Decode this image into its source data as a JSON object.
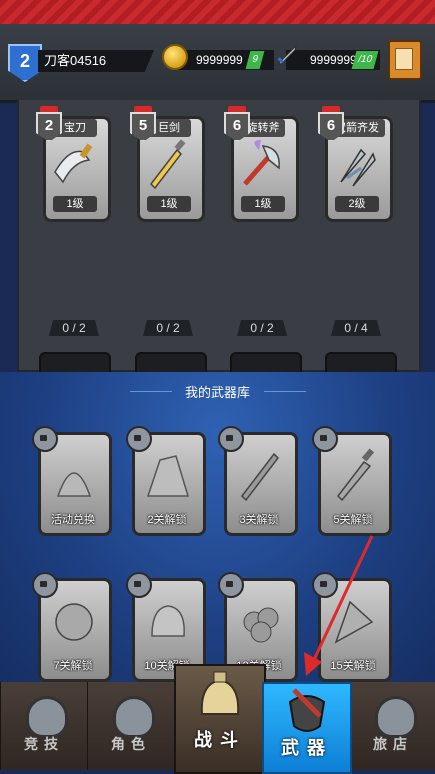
{
  "player": {
    "level": "2",
    "name": "刀客04516"
  },
  "resources": {
    "gold": "9999999",
    "gold_plus": "9",
    "energy": "99999999",
    "energy_max": "/10"
  },
  "equipped": [
    {
      "name": "宝刀",
      "badge": "2",
      "level": "1级",
      "progress": "0 / 2"
    },
    {
      "name": "巨剑",
      "badge": "5",
      "level": "1级",
      "progress": "0 / 2"
    },
    {
      "name": "旋转斧",
      "badge": "6",
      "level": "1级",
      "progress": "0 / 2"
    },
    {
      "name": "双箭齐发",
      "badge": "6",
      "level": "2级",
      "progress": "0 / 4"
    }
  ],
  "library": {
    "title": "我的武器库",
    "items": [
      {
        "caption": "活动兑换"
      },
      {
        "caption": "2关解锁"
      },
      {
        "caption": "3关解锁"
      },
      {
        "caption": "5关解锁"
      },
      {
        "caption": "7关解锁"
      },
      {
        "caption": "10关解锁"
      },
      {
        "caption": "12关解锁"
      },
      {
        "caption": "15关解锁"
      }
    ]
  },
  "nav": {
    "arena": "竞技",
    "character": "角色",
    "battle": "战斗",
    "weapons": "武器",
    "shop": "旅店"
  },
  "colors": {
    "accent_blue": "#1a9cf0",
    "arrow_red": "#e02a2a"
  }
}
